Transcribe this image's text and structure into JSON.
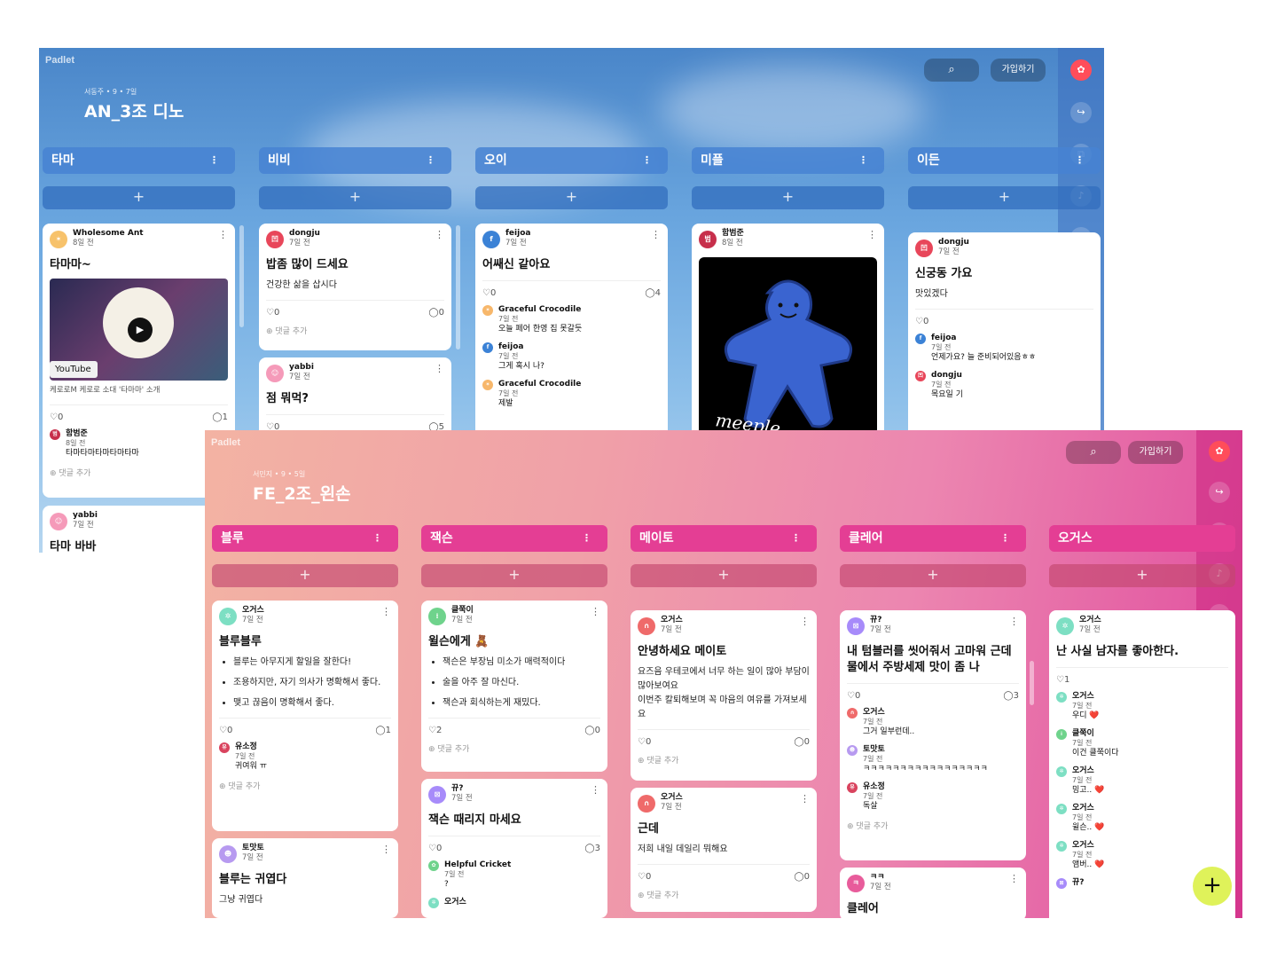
{
  "win1": {
    "logo": "Padlet",
    "meta": "서동주 • 9 • 7일",
    "title": "AN_3조 디노",
    "join": "가입하기",
    "columns": [
      "타마",
      "비비",
      "오이",
      "미플",
      "이든"
    ],
    "add": "+",
    "cards": {
      "c1": {
        "author": "Wholesome Ant",
        "time": "8일 전",
        "title": "타마마~",
        "video_source": "YouTube",
        "caption": "케로로M 케로로 소대 '타마마' 소개",
        "likes": "0",
        "comments": "1",
        "comment1": {
          "author": "함범준",
          "time": "8일 전",
          "text": "타마타마타마타마타마"
        },
        "add_comment": "댓글 추가"
      },
      "c1b": {
        "author": "yabbi",
        "time": "7일 전",
        "title": "타마 바바"
      },
      "c2": {
        "author": "dongju",
        "time": "7일 전",
        "title": "밥좀 많이 드세요",
        "body": "건강한 삶을 삽시다",
        "likes": "0",
        "comments": "0",
        "add_comment": "댓글 추가"
      },
      "c2b": {
        "author": "yabbi",
        "time": "7일 전",
        "title": "점 뭐먹?",
        "likes": "0",
        "comments": "5"
      },
      "c3": {
        "author": "feijoa",
        "time": "7일 전",
        "title": "어쌔신 같아요",
        "likes": "0",
        "comments": "4",
        "comment_list": [
          {
            "author": "Graceful Crocodile",
            "time": "7일 전",
            "text": "오늘 페어 한영 집 못갈듯"
          },
          {
            "author": "feijoa",
            "time": "7일 전",
            "text": "그게 혹시 나?"
          },
          {
            "author": "Graceful Crocodile",
            "time": "7일 전",
            "text": "제발"
          }
        ]
      },
      "c4": {
        "author": "함범준",
        "time": "8일 전",
        "image_text": "meeple"
      },
      "c5": {
        "author": "dongju",
        "time": "7일 전",
        "title": "신궁동 가요",
        "body": "맛있겠다",
        "likes": "0",
        "comment_list": [
          {
            "author": "feijoa",
            "time": "7일 전",
            "text": "언제가요? 늘 준비되어있음ㅎㅎ"
          },
          {
            "author": "dongju",
            "time": "7일 전",
            "text": "목요일 기"
          }
        ]
      }
    }
  },
  "win2": {
    "logo": "Padlet",
    "meta": "서민지 • 9 • 5일",
    "title": "FE_2조_왼손",
    "join": "가입하기",
    "columns": [
      "블루",
      "잭슨",
      "메이토",
      "클레어",
      "오거스"
    ],
    "add": "+",
    "cards": {
      "d1": {
        "author": "오거스",
        "time": "7일 전",
        "title": "블루블루",
        "bullets": [
          "블루는 아무지게 할일을 잘한다!",
          "조용하지만, 자기 의사가 명확해서 좋다.",
          "맺고 끊음이 명확해서 좋다."
        ],
        "likes": "0",
        "comments": "1",
        "comment1": {
          "author": "유소정",
          "time": "7일 전",
          "text": "귀여워 ㅠ"
        },
        "add_comment": "댓글 추가"
      },
      "d1b": {
        "author": "토맛토",
        "time": "7일 전",
        "title": "블루는 귀엽다",
        "body": "그냥 귀엽다"
      },
      "d2": {
        "author": "클쭉이",
        "time": "7일 전",
        "title": "윌슨에게 🧸",
        "bullets": [
          "잭슨은 부장님 미소가 매력적이다",
          "술을 아주 잘 마신다.",
          "잭슨과 회식하는게 재밌다."
        ],
        "likes": "2",
        "comments": "0",
        "add_comment": "댓글 추가"
      },
      "d2b": {
        "author": "뀨?",
        "time": "7일 전",
        "title": "잭슨 때리지 마세요",
        "likes": "0",
        "comments": "3",
        "comment1": {
          "author": "Helpful Cricket",
          "time": "7일 전",
          "text": "?"
        },
        "comment2_author": "오거스"
      },
      "d3": {
        "author": "오거스",
        "time": "7일 전",
        "title": "안녕하세요 메이토",
        "body1": "요즈음 우테코에서 너무 하는 일이 많아 부담이 많아보여요",
        "body2": "이번주 칼퇴해보며 꼭 마음의 여유를 가져보세요",
        "likes": "0",
        "comments": "0",
        "add_comment": "댓글 추가"
      },
      "d3b": {
        "author": "오거스",
        "time": "7일 전",
        "title": "근데",
        "body": "저희 내일 데일리 뭐해요",
        "likes": "0",
        "comments": "0",
        "add_comment": "댓글 추가"
      },
      "d4": {
        "author": "뀨?",
        "time": "7일 전",
        "title": "내 텀블러를 씻어줘서 고마워 근데 물에서 주방세제 맛이 좀 나",
        "likes": "0",
        "comments": "3",
        "comment_list": [
          {
            "author": "오거스",
            "time": "7일 전",
            "text": "그거 일부런데.."
          },
          {
            "author": "토맛토",
            "time": "7일 전",
            "text": "ㅋㅋㅋㅋㅋㅋㅋㅋㅋㅋㅋㅋㅋㅋㅋㅋㅋ"
          },
          {
            "author": "유소정",
            "time": "7일 전",
            "text": "독살"
          }
        ],
        "add_comment": "댓글 추가"
      },
      "d4b": {
        "author": "ㅋㅋ",
        "time": "7일 전",
        "title": "클레어"
      },
      "d5": {
        "author": "오거스",
        "time": "7일 전",
        "title": "난 사실 남자를 좋아한다.",
        "likes": "1",
        "comment_list": [
          {
            "author": "오거스",
            "time": "7일 전",
            "text": "우디 ❤️"
          },
          {
            "author": "클쭉이",
            "time": "7일 전",
            "text": "이건 클쭉이다"
          },
          {
            "author": "오거스",
            "time": "7일 전",
            "text": "밍고.. ❤️"
          },
          {
            "author": "오거스",
            "time": "7일 전",
            "text": "윌슨.. ❤️"
          },
          {
            "author": "오거스",
            "time": "7일 전",
            "text": "앰버.. ❤️"
          },
          {
            "author": "뀨?",
            "time": "",
            "text": ""
          }
        ]
      }
    }
  },
  "icons": {
    "search": "search-icon",
    "share": "share-icon",
    "remake": "remake-icon",
    "bell": "bell-icon",
    "play": "play-icon",
    "more": "more-icon",
    "heart": "heart-icon",
    "comment": "comment-icon"
  }
}
